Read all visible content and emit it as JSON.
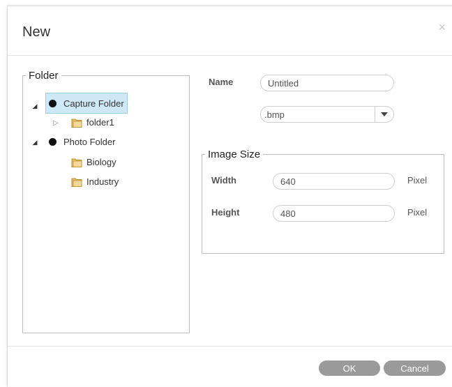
{
  "dialog": {
    "title": "New",
    "close_glyph": "×"
  },
  "folder_panel": {
    "legend": "Folder",
    "tree": [
      {
        "label": "Capture Folder",
        "icon": "dot-icon",
        "expanded": true,
        "selected": true
      },
      {
        "label": "folder1",
        "icon": "folder-icon",
        "expanded": false
      },
      {
        "label": "Photo Folder",
        "icon": "dot-icon",
        "expanded": true
      },
      {
        "label": "Biology",
        "icon": "folder-icon"
      },
      {
        "label": "Industry",
        "icon": "folder-icon"
      }
    ]
  },
  "form": {
    "name_label": "Name",
    "name_value": "Untitled",
    "format_value": ".bmp"
  },
  "image_size": {
    "legend": "Image Size",
    "width_label": "Width",
    "width_value": "640",
    "width_unit": "Pixel",
    "height_label": "Height",
    "height_value": "480",
    "height_unit": "Pixel"
  },
  "footer": {
    "ok_label": "OK",
    "cancel_label": "Cancel"
  },
  "colors": {
    "selection_bg": "#cfe8f6",
    "button_bg": "#9a9a9a",
    "folder_icon": "#e8c06a"
  }
}
